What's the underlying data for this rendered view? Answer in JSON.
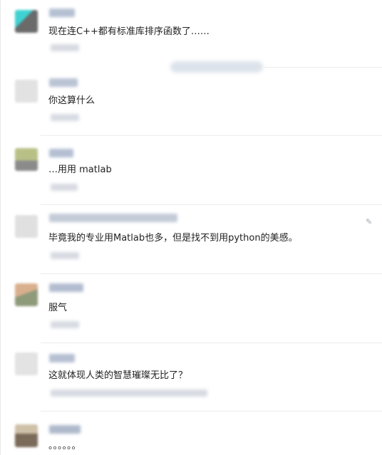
{
  "comments": [
    {
      "text": "现在连C++都有标准库排序函数了……"
    },
    {
      "text": "你这算什么"
    },
    {
      "text": "…用用 matlab"
    },
    {
      "text": "毕竟我的专业用Matlab也多，但是找不到用python的美感。"
    },
    {
      "text": "服气"
    },
    {
      "text": "这就体现人类的智慧璀璨无比了？"
    },
    {
      "text": "。。。。。。"
    }
  ],
  "colors": {
    "text": "#222222",
    "divider": "#ececec",
    "blurred_name": "#aeb9cc",
    "blurred_meta": "#d7dbe2"
  },
  "icons": [
    "avatar",
    "reply-icon"
  ]
}
